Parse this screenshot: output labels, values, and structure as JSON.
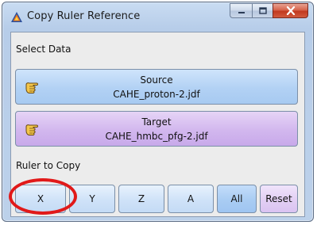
{
  "window": {
    "title": "Copy Ruler Reference",
    "icons": {
      "app": "app-logo-icon",
      "minimize": "minimize-icon",
      "maximize": "maximize-icon",
      "close": "close-icon"
    }
  },
  "select_data": {
    "label": "Select Data",
    "source": {
      "title": "Source",
      "file": "CAHE_proton-2.jdf",
      "icon": "pointing-hand-icon",
      "color": "#b2d1f4"
    },
    "target": {
      "title": "Target",
      "file": "CAHE_hmbc_pfg-2.jdf",
      "icon": "pointing-hand-icon",
      "color": "#d2b7ee"
    }
  },
  "ruler": {
    "label": "Ruler to Copy",
    "buttons": [
      "X",
      "Y",
      "Z",
      "A",
      "All",
      "Reset"
    ]
  },
  "annotation": {
    "highlight_color": "#e11919"
  }
}
